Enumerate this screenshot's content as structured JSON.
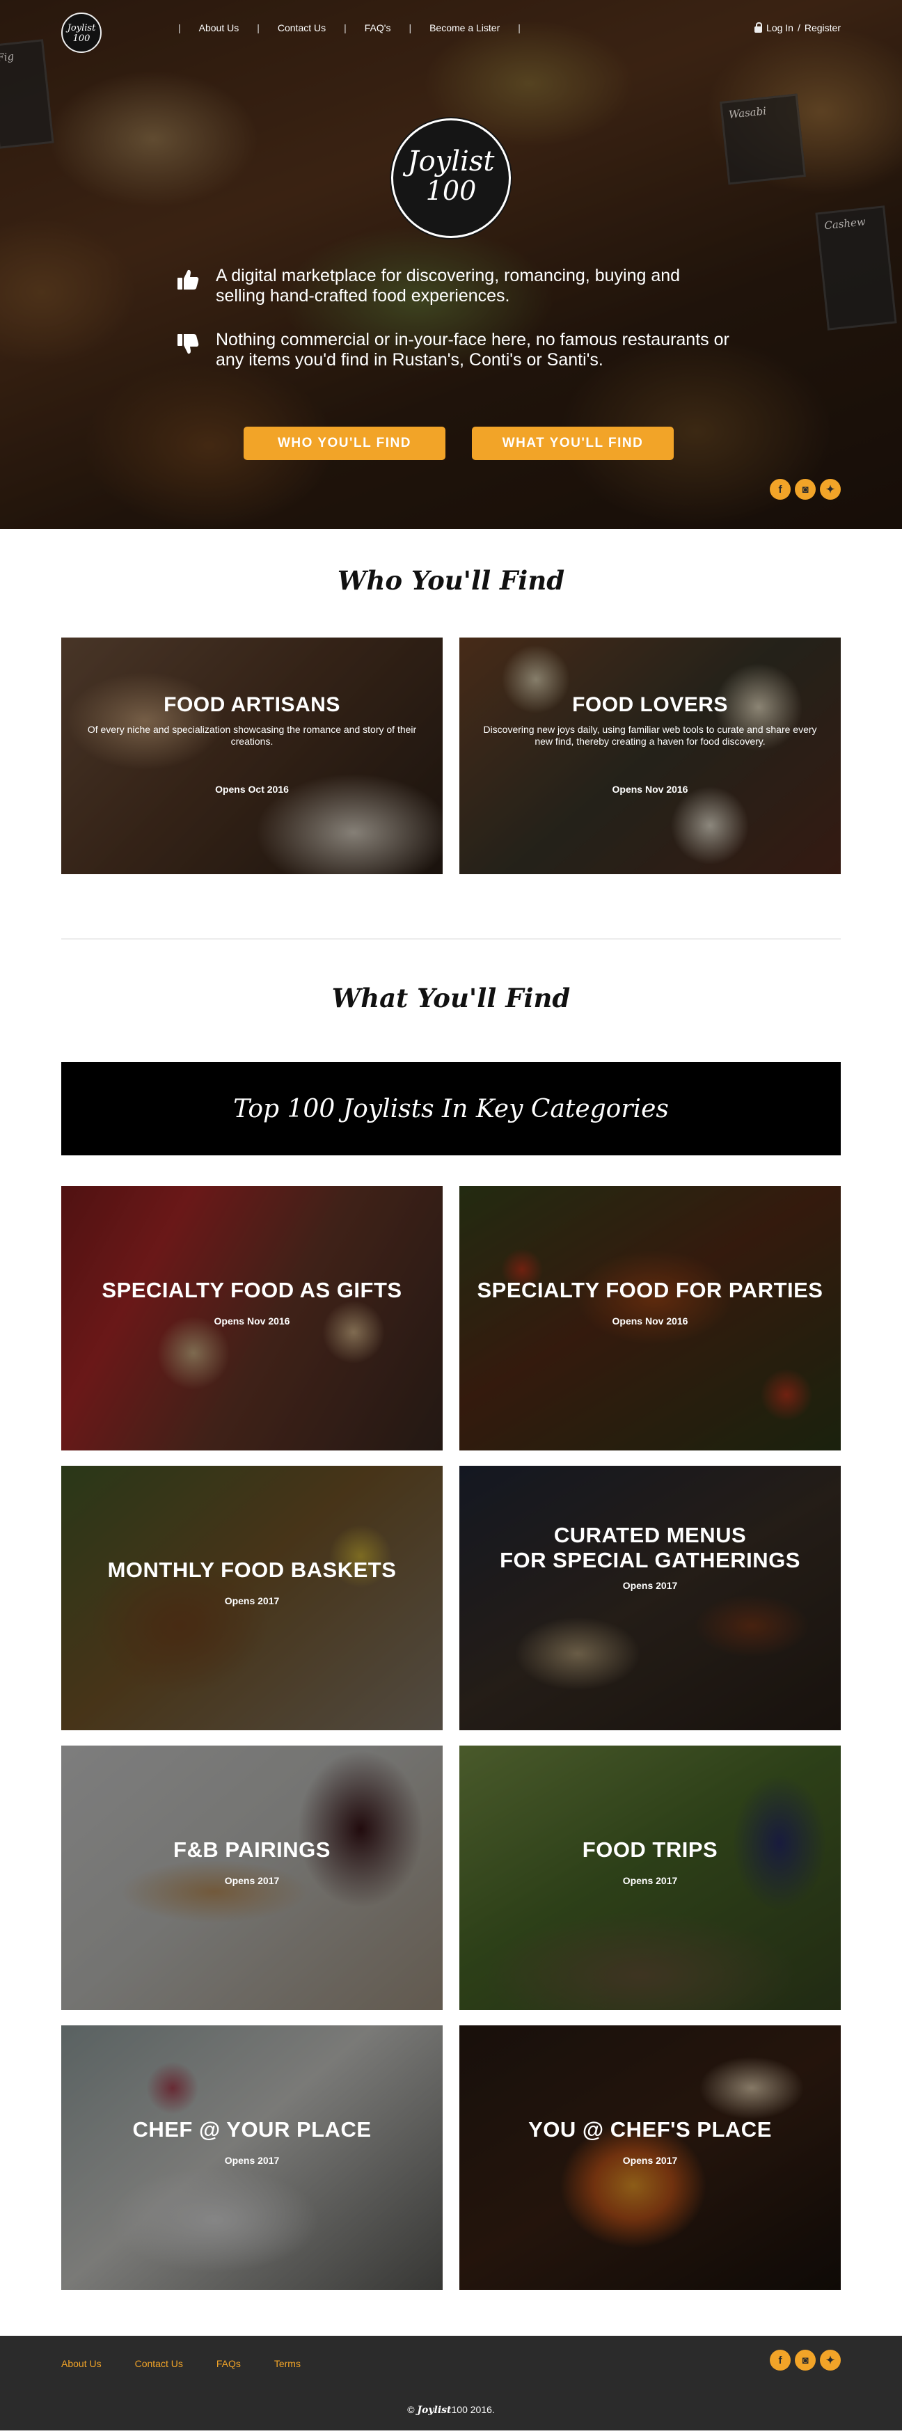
{
  "nav": {
    "logo": {
      "line1": "Joylist",
      "line2": "100"
    },
    "links": [
      "About Us",
      "Contact Us",
      "FAQ's",
      "Become a Lister"
    ],
    "auth": {
      "login": "Log In",
      "separator": "/",
      "register": "Register"
    }
  },
  "hero": {
    "logo": {
      "line1": "Joylist",
      "line2": "100"
    },
    "chalkboards": [
      "Wasabi",
      "Cashew",
      "Fig"
    ],
    "tagline1": "A digital marketplace for discovering, romancing, buying and selling hand-crafted food experiences.",
    "tagline2": "Nothing commercial or in-your-face here, no famous restaurants or any items you'd find  in Rustan's, Conti's or Santi's.",
    "btn_who": "WHO YOU'LL FIND",
    "btn_what": "WHAT YOU'LL FIND",
    "social_icons": [
      "facebook-icon",
      "instagram-icon",
      "twitter-icon"
    ]
  },
  "who": {
    "title": "Who You'll Find",
    "cards": [
      {
        "title": "FOOD ARTISANS",
        "desc": "Of every niche and specialization showcasing the romance and story of their creations.",
        "opens": "Opens Oct 2016"
      },
      {
        "title": "FOOD LOVERS",
        "desc": "Discovering new joys daily, using familiar web tools to curate and share every new find, thereby creating a haven for food discovery.",
        "opens": "Opens Nov 2016"
      }
    ]
  },
  "what": {
    "title": "What You'll Find",
    "banner": "Top 100 Joylists In Key Categories",
    "cards": [
      {
        "title": "SPECIALTY FOOD AS GIFTS",
        "opens": "Opens Nov 2016"
      },
      {
        "title": "SPECIALTY FOOD FOR PARTIES",
        "opens": "Opens Nov 2016"
      },
      {
        "title": "MONTHLY FOOD BASKETS",
        "opens": "Opens 2017"
      },
      {
        "title_line1": "CURATED MENUS",
        "title_line2": "FOR SPECIAL GATHERINGS",
        "opens": "Opens 2017"
      },
      {
        "title": "F&B PAIRINGS",
        "opens": "Opens 2017"
      },
      {
        "title": "FOOD TRIPS",
        "opens": "Opens 2017"
      },
      {
        "title": "CHEF @ YOUR PLACE",
        "opens": "Opens 2017"
      },
      {
        "title": "YOU @ CHEF'S PLACE",
        "opens": "Opens 2017"
      }
    ]
  },
  "footer": {
    "links": [
      "About Us",
      "Contact Us",
      "FAQs",
      "Terms"
    ],
    "copyright_prefix": "©",
    "brand": "Joylist",
    "brand_num": "100",
    "year": "2016."
  },
  "colors": {
    "accent": "#f2a428",
    "footer_bg": "#2b2b2b",
    "banner_bg": "#000000"
  }
}
